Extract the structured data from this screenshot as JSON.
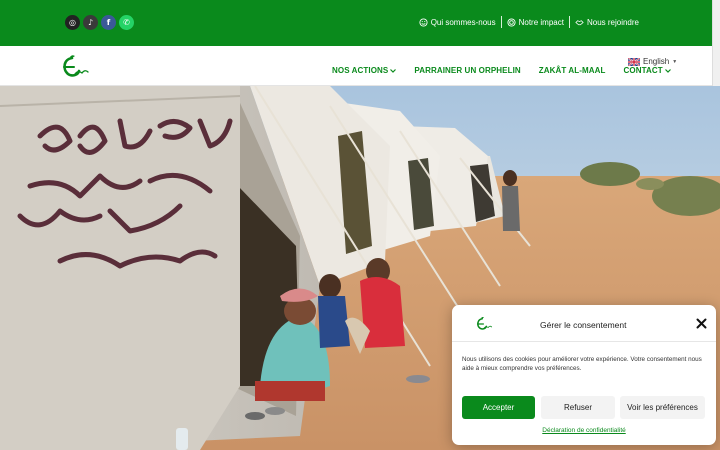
{
  "topbar": {
    "social": [
      {
        "icon": "instagram-icon",
        "glyph": "◎"
      },
      {
        "icon": "tiktok-icon",
        "glyph": "♪"
      },
      {
        "icon": "facebook-icon",
        "glyph": "f"
      },
      {
        "icon": "whatsapp-icon",
        "glyph": "✆"
      }
    ],
    "links": [
      {
        "label": "Qui sommes-nous",
        "icon": "smiley-icon"
      },
      {
        "label": "Notre impact",
        "icon": "target-icon"
      },
      {
        "label": "Nous rejoindre",
        "icon": "handshake-icon"
      }
    ]
  },
  "nav": {
    "items": [
      {
        "label": "NOS ACTIONS",
        "has_dropdown": true
      },
      {
        "label": "PARRAINER UN ORPHELIN",
        "has_dropdown": false
      },
      {
        "label": "ZAKÂT AL-MAAL",
        "has_dropdown": false
      },
      {
        "label": "CONTACT",
        "has_dropdown": true
      }
    ],
    "language": "English"
  },
  "consent": {
    "title": "Gérer le consentement",
    "text": "Nous utilisons des cookies pour améliorer votre expérience. Votre consentement nous aide à mieux comprendre vos préférences.",
    "accept": "Accepter",
    "refuse": "Refuser",
    "prefs": "Voir les préférences",
    "policy": "Déclaration de confidentialité"
  },
  "colors": {
    "brand_green": "#0a8a1c"
  }
}
